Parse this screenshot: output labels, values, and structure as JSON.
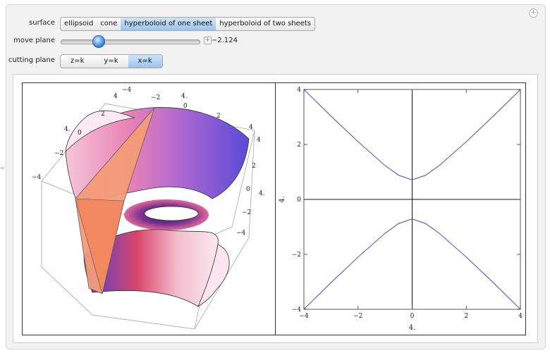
{
  "controls": {
    "surface_label": "surface",
    "surface_options": [
      "ellipsoid",
      "cone",
      "hyperboloid of one sheet",
      "hyperboloid of two sheets"
    ],
    "surface_selected": "hyperboloid of one sheet",
    "move_plane_label": "move plane",
    "move_plane_value": "−2.124",
    "move_plane_fraction": 0.27,
    "cutting_plane_label": "cutting plane",
    "cutting_plane_options": [
      "z=k",
      "y=k",
      "x=k"
    ],
    "cutting_plane_selected": "x=k"
  },
  "surface3d": {
    "top_axis_ticks": [
      "−4",
      "−2",
      "4.",
      "0",
      "2",
      "4"
    ],
    "left_axis_ticks": [
      "4",
      "2",
      "4.",
      "0",
      "−2",
      "−4"
    ],
    "right_axis_ticks": [
      "4",
      "2",
      "0",
      "4.",
      "−2",
      "−4"
    ]
  },
  "chart_data": {
    "type": "line",
    "xlabel": "4.",
    "ylabel": "4.",
    "xlim": [
      -4,
      4
    ],
    "ylim": [
      -4,
      4
    ],
    "x_ticks": [
      "−4",
      "−2",
      "0",
      "2",
      "4"
    ],
    "y_ticks": [
      "−4",
      "−2",
      "0",
      "2",
      "4"
    ],
    "series": [
      {
        "x": [
          -4,
          -3,
          -2,
          -1,
          -0.5,
          0,
          0.5,
          1,
          2,
          3,
          4
        ],
        "y": [
          4.0,
          3.03,
          2.1,
          1.23,
          0.88,
          0.71,
          0.88,
          1.23,
          2.1,
          3.03,
          4.0
        ]
      },
      {
        "x": [
          -4,
          -3,
          -2,
          -1,
          -0.5,
          0,
          0.5,
          1,
          2,
          3,
          4
        ],
        "y": [
          -4.0,
          -3.03,
          -2.1,
          -1.23,
          -0.88,
          -0.71,
          -0.88,
          -1.23,
          -2.1,
          -3.03,
          -4.0
        ]
      }
    ]
  }
}
